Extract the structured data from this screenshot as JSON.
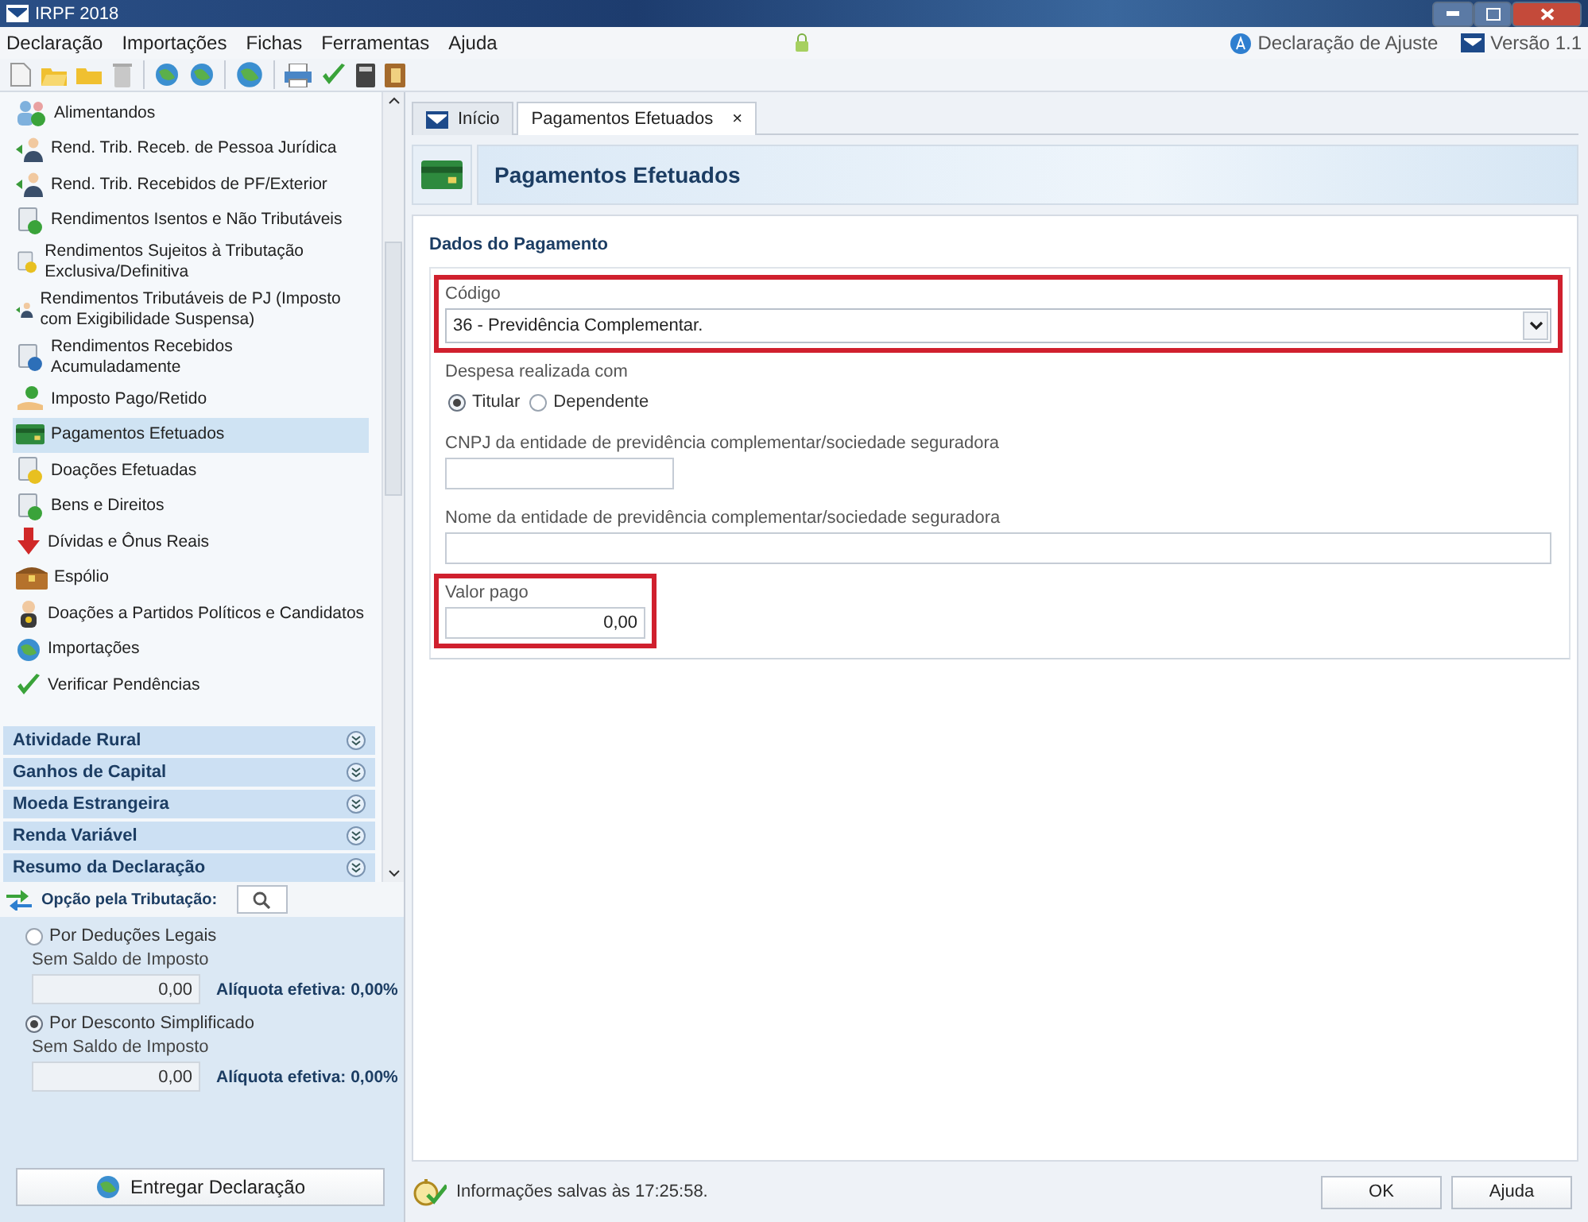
{
  "window": {
    "title": "IRPF 2018"
  },
  "menu": [
    "Declaração",
    "Importações",
    "Fichas",
    "Ferramentas",
    "Ajuda"
  ],
  "header_links": [
    {
      "label": "Declaração de Ajuste"
    },
    {
      "label": "Versão 1.1"
    }
  ],
  "sidebar": {
    "items": [
      {
        "label": "Alimentandos",
        "selected": false
      },
      {
        "label": "Rend. Trib. Receb. de Pessoa Jurídica",
        "selected": false
      },
      {
        "label": "Rend. Trib. Recebidos de PF/Exterior",
        "selected": false
      },
      {
        "label": "Rendimentos Isentos e Não Tributáveis",
        "selected": false
      },
      {
        "label": "Rendimentos Sujeitos à Tributação Exclusiva/Definitiva",
        "selected": false
      },
      {
        "label": "Rendimentos Tributáveis de PJ (Imposto com Exigibilidade Suspensa)",
        "selected": false
      },
      {
        "label": "Rendimentos Recebidos Acumuladamente",
        "selected": false
      },
      {
        "label": "Imposto Pago/Retido",
        "selected": false
      },
      {
        "label": "Pagamentos Efetuados",
        "selected": true
      },
      {
        "label": "Doações Efetuadas",
        "selected": false
      },
      {
        "label": "Bens e Direitos",
        "selected": false
      },
      {
        "label": "Dívidas e Ônus Reais",
        "selected": false
      },
      {
        "label": "Espólio",
        "selected": false
      },
      {
        "label": "Doações a Partidos Políticos e Candidatos",
        "selected": false
      },
      {
        "label": "Importações",
        "selected": false
      },
      {
        "label": "Verificar Pendências",
        "selected": false
      }
    ],
    "groups": [
      "Atividade Rural",
      "Ganhos de Capital",
      "Moeda Estrangeira",
      "Renda Variável",
      "Resumo da Declaração"
    ],
    "tax_option": {
      "title": "Opção pela Tributação:",
      "options": [
        {
          "label": "Por Deduções Legais",
          "selected": false,
          "caption": "Sem Saldo de Imposto",
          "value": "0,00",
          "rate": "Alíquota efetiva: 0,00%"
        },
        {
          "label": "Por Desconto Simplificado",
          "selected": true,
          "caption": "Sem Saldo de Imposto",
          "value": "0,00",
          "rate": "Alíquota efetiva: 0,00%"
        }
      ]
    },
    "submit_button": "Entregar Declaração"
  },
  "tabs": [
    {
      "label": "Início",
      "selected": false,
      "closable": false
    },
    {
      "label": "Pagamentos Efetuados",
      "selected": true,
      "closable": true,
      "close_label": "×"
    }
  ],
  "page": {
    "title": "Pagamentos Efetuados",
    "section": "Dados do Pagamento",
    "fields": [
      {
        "kind": "select",
        "label": "Código",
        "value": "36 - Previdência Complementar.",
        "highlighted": true
      },
      {
        "kind": "radio",
        "label": "Despesa realizada com",
        "options": [
          {
            "label": "Titular",
            "selected": true
          },
          {
            "label": "Dependente",
            "selected": false
          }
        ],
        "highlighted": false
      },
      {
        "kind": "short",
        "label": "CNPJ da entidade de previdência complementar/sociedade seguradora",
        "highlighted": false
      },
      {
        "kind": "wide",
        "label": "Nome da entidade de previdência complementar/sociedade seguradora",
        "highlighted": false
      },
      {
        "kind": "money",
        "label": "Valor pago",
        "value": "0,00",
        "highlighted": true
      }
    ]
  },
  "footer": {
    "status": "Informações salvas às 17:25:58.",
    "buttons": [
      "OK",
      "Ajuda"
    ]
  }
}
